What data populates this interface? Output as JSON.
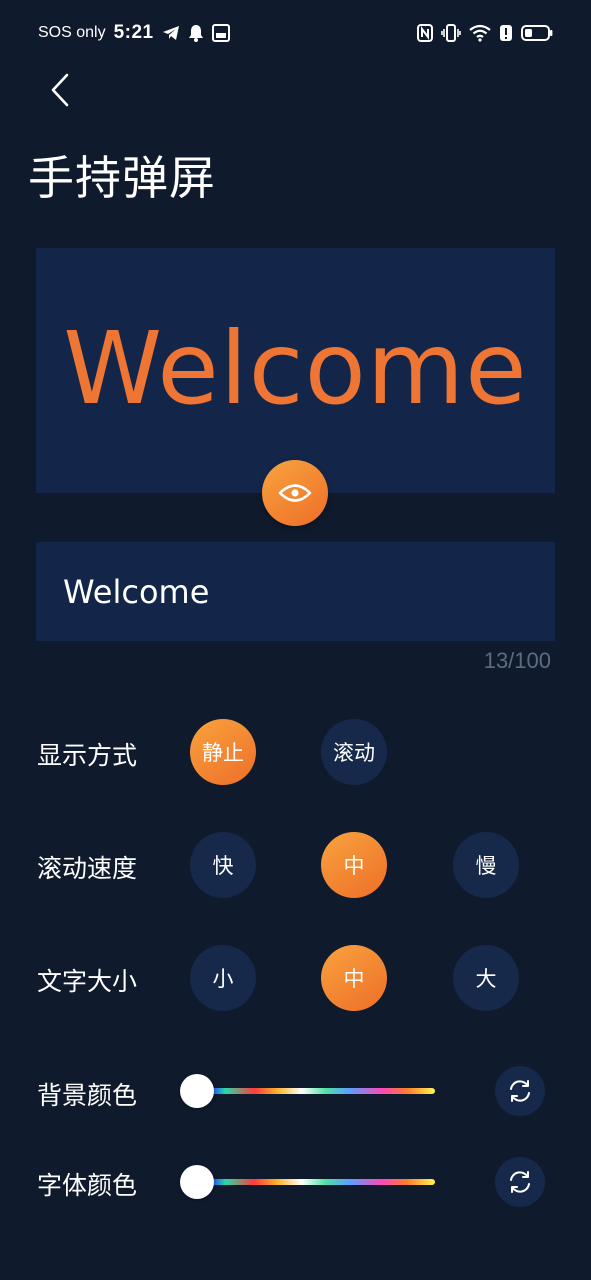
{
  "status_bar": {
    "carrier": "SOS only",
    "time": "5:21"
  },
  "page": {
    "title": "手持弹屏"
  },
  "preview": {
    "text": "Welcome"
  },
  "input": {
    "value": "Welcome",
    "counter": "13/100"
  },
  "display_mode": {
    "label": "显示方式",
    "options": [
      "静止",
      "滚动"
    ],
    "selected": "静止"
  },
  "scroll_speed": {
    "label": "滚动速度",
    "options": [
      "快",
      "中",
      "慢"
    ],
    "selected": "中"
  },
  "text_size": {
    "label": "文字大小",
    "options": [
      "小",
      "中",
      "大"
    ],
    "selected": "中"
  },
  "bg_color": {
    "label": "背景颜色",
    "slider_value": 0
  },
  "font_color": {
    "label": "字体颜色",
    "slider_value": 0
  },
  "colors": {
    "background": "#0f1a2d",
    "panel": "#13264a",
    "accent": "#ee7534",
    "option_bg": "#16294a"
  },
  "icons": {
    "back": "chevron-left-icon",
    "preview": "eye-icon",
    "reset": "refresh-icon"
  }
}
